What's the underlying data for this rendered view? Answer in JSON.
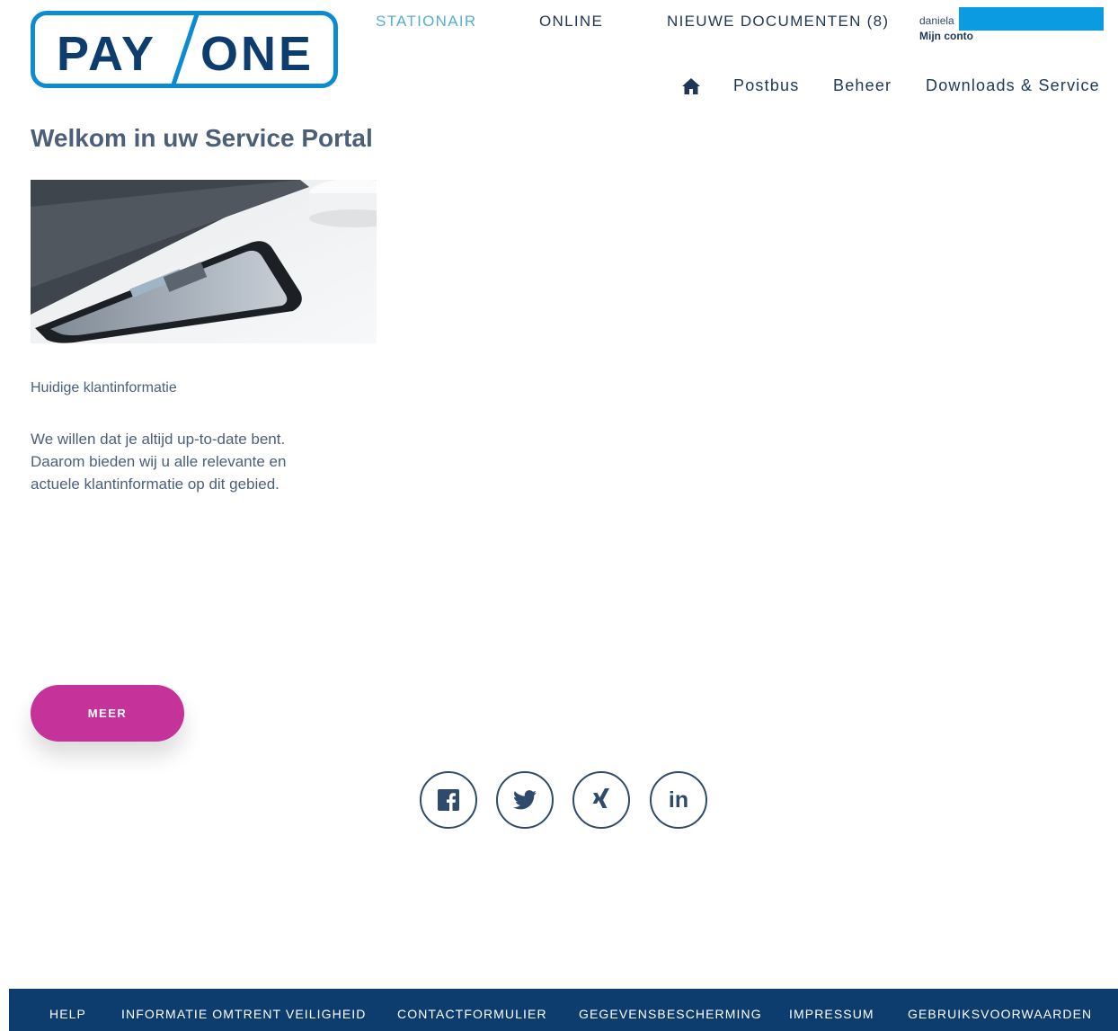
{
  "logo": {
    "text_left": "PAY",
    "text_right": "ONE",
    "color": "#0b8bd0"
  },
  "topnav": {
    "stationair": "STATIONAIR",
    "online": "ONLINE",
    "docs": "NIEUWE DOCUMENTEN (8)"
  },
  "user": {
    "name": "daniela",
    "account_link": "Mijn conto"
  },
  "subnav": {
    "postbus": "Postbus",
    "beheer": "Beheer",
    "downloads": "Downloads & Service"
  },
  "main": {
    "title": "Welkom in uw Service Portal",
    "section_label": "Huidige klantinformatie",
    "description_lines": [
      "We willen dat je altijd up-to-date bent.",
      "Daarom bieden wij u alle relevante en",
      "actuele klantinformatie op dit gebied."
    ],
    "more_button": "MEER"
  },
  "social": {
    "facebook": "facebook-icon",
    "twitter": "twitter-icon",
    "xing": "xing-icon",
    "linkedin": "in"
  },
  "footer": {
    "help": "HELP",
    "security": "INFORMATIE OMTRENT VEILIGHEID",
    "contact": "CONTACTFORMULIER",
    "privacy": "GEGEVENSBESCHERMING",
    "impressum": "IMPRESSUM",
    "terms": "GEBRUIKSVOORWAARDEN"
  },
  "colors": {
    "accent": "#56aed0",
    "button": "#c5329a",
    "footer": "#0d3d6f",
    "text": "#1f3656",
    "redaction": "#0b9be0"
  }
}
